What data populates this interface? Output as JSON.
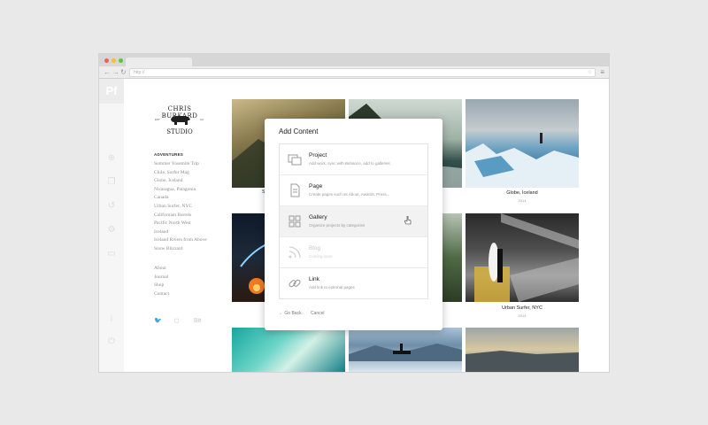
{
  "browser": {
    "url": "http://"
  },
  "app": {
    "logo": "Pf"
  },
  "site": {
    "logo_top": "CHRIS BURKARD",
    "logo_mid_left": "EST",
    "logo_mid_right": "CA",
    "logo_bottom": "STUDIO",
    "section_title": "ADVENTURES",
    "projects": [
      "Summer Yosemite Trip",
      "Chile, Surfer Mag",
      "Globe, Iceland",
      "Nicaragua, Patagonia",
      "Canada",
      "Urban Surfer, NYC",
      "Californian Barrels",
      "Pacific North West",
      "Iceland",
      "Iceland Rivers from Above",
      "Snow Blizzard"
    ],
    "pages": [
      "About",
      "Journal",
      "Shop",
      "Contact"
    ],
    "social_icons": [
      "twitter-icon",
      "instagram-icon",
      "behance-icon"
    ]
  },
  "grid": {
    "captions": {
      "r1c1_partial": "S",
      "r1c3_title": "Globe, Iceland",
      "r1c3_sub": "2014",
      "r2c3_title": "Urban Surfer, NYC",
      "r2c3_sub": "2014"
    }
  },
  "modal": {
    "title": "Add Content",
    "options": [
      {
        "label": "Project",
        "desc": "Add work, sync with Behance, add to galleries",
        "icon": "project-icon",
        "state": "normal"
      },
      {
        "label": "Page",
        "desc": "Create pages such as About, Awards, Press...",
        "icon": "page-icon",
        "state": "normal"
      },
      {
        "label": "Gallery",
        "desc": "Organize projects by categories",
        "icon": "gallery-icon",
        "state": "hover"
      },
      {
        "label": "Blog",
        "desc": "Coming soon",
        "icon": "rss-icon",
        "state": "disabled"
      },
      {
        "label": "Link",
        "desc": "Add link to external pages",
        "icon": "link-icon",
        "state": "normal"
      }
    ],
    "back_label": "← Go Back",
    "cancel_label": "Cancel"
  }
}
